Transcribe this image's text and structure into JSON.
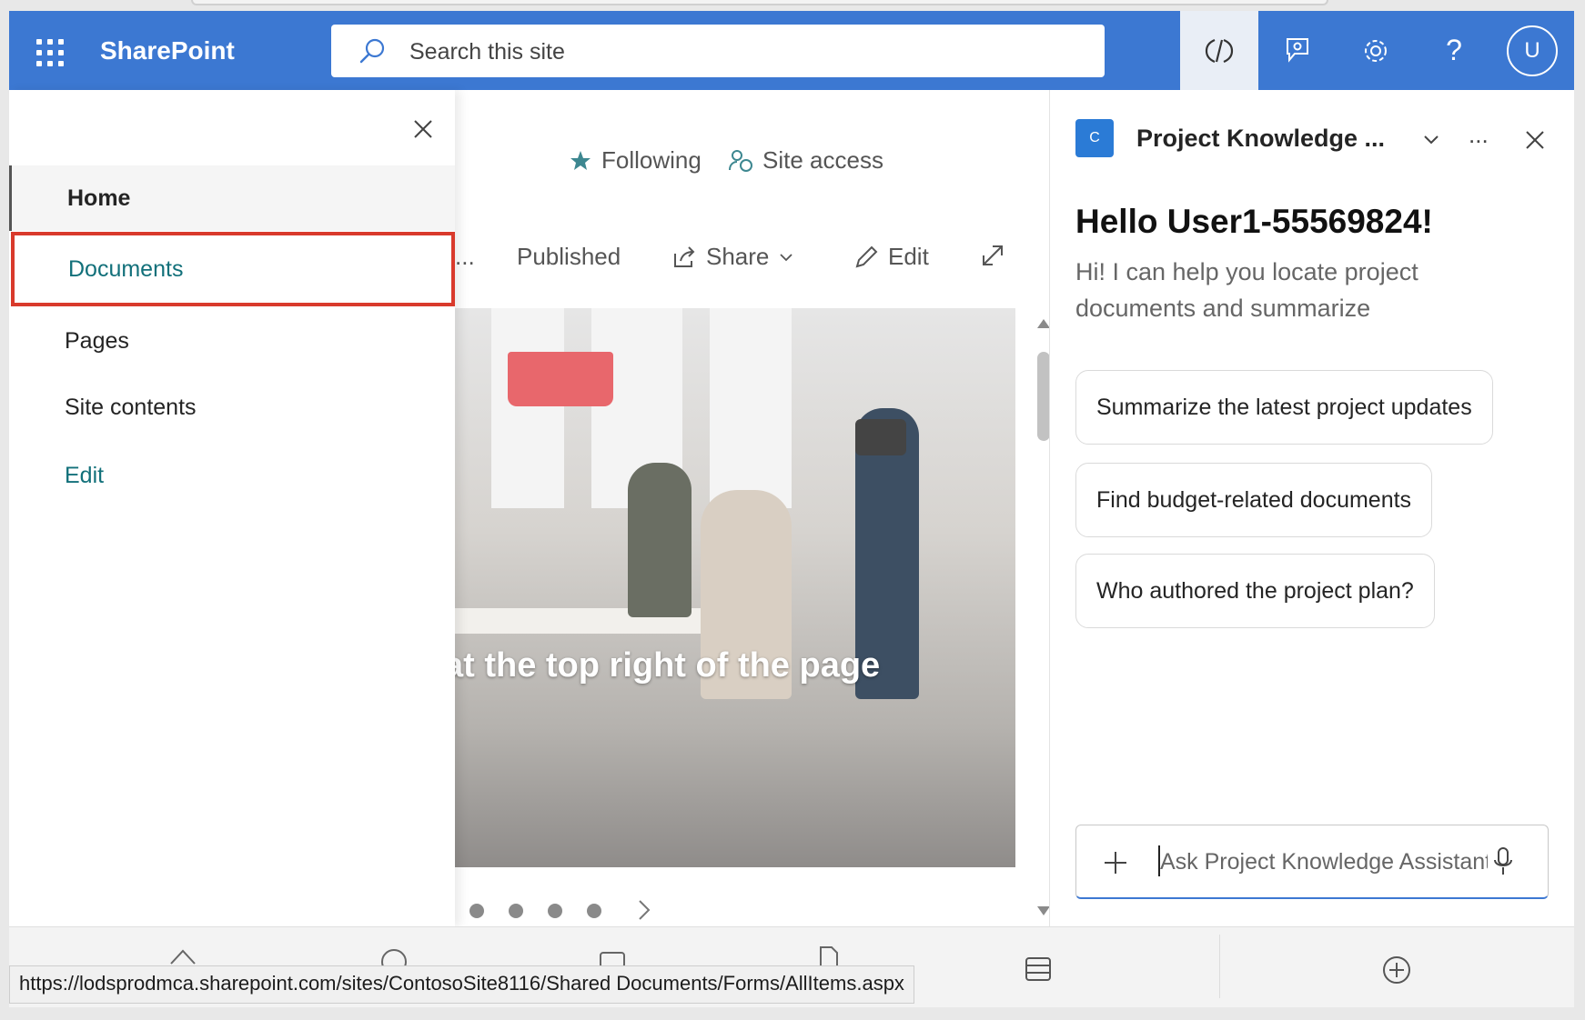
{
  "suitebar": {
    "brand": "SharePoint",
    "search_placeholder": "Search this site",
    "avatar_initial": "U",
    "help_glyph": "?"
  },
  "nav": {
    "items": [
      {
        "label": "Home"
      },
      {
        "label": "Documents"
      },
      {
        "label": "Pages"
      },
      {
        "label": "Site contents"
      },
      {
        "label": "Edit"
      }
    ]
  },
  "main": {
    "following_label": "Following",
    "site_access_label": "Site access",
    "more_label": "...",
    "published_label": "Published",
    "share_label": "Share",
    "edit_label": "Edit",
    "hero_text": "at the top right of the page",
    "carousel_dots": 4
  },
  "pane": {
    "logo_letter": "C",
    "title": "Project Knowledge ...",
    "more_label": "...",
    "greeting": "Hello User1-55569824!",
    "subtitle": "Hi! I can help you locate project documents and summarize",
    "suggestions": [
      "Summarize the latest project updates",
      "Find budget-related documents",
      "Who authored the project plan?"
    ],
    "input_placeholder": "Ask Project Knowledge Assistant"
  },
  "status_url": "https://lodsprodmca.sharepoint.com/sites/ContosoSite8116/Shared Documents/Forms/AllItems.aspx",
  "colors": {
    "suitebar": "#3c78d2",
    "nav_highlight_border": "#d93a2c",
    "link_teal": "#12707a"
  }
}
